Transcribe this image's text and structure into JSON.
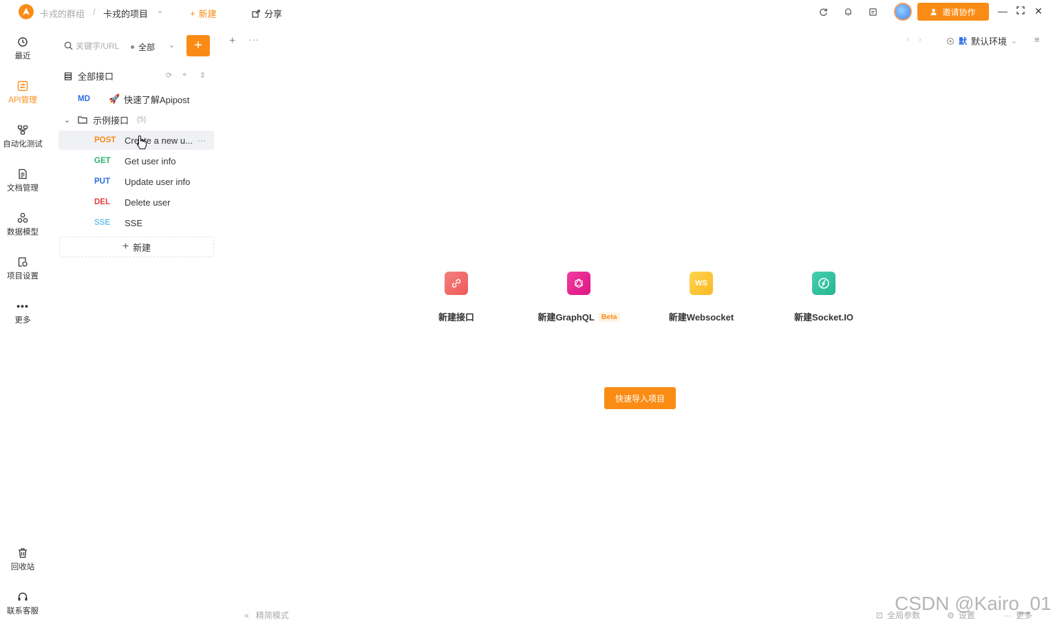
{
  "titlebar": {
    "team": "卡戎的群组",
    "separator": "/",
    "project": "卡戎的项目",
    "new_label": "新建",
    "share_label": "分享",
    "invite_label": "邀请协作"
  },
  "leftnav": {
    "items": [
      {
        "label": "最近",
        "icon": "history-icon"
      },
      {
        "label": "API管理",
        "icon": "api-icon"
      },
      {
        "label": "自动化测试",
        "icon": "automation-icon"
      },
      {
        "label": "文档管理",
        "icon": "document-icon"
      },
      {
        "label": "数据模型",
        "icon": "data-model-icon"
      },
      {
        "label": "项目设置",
        "icon": "project-settings-icon"
      },
      {
        "label": "更多",
        "icon": "more-icon"
      }
    ],
    "bottom": [
      {
        "label": "回收站",
        "icon": "trash-icon"
      },
      {
        "label": "联系客服",
        "icon": "headset-icon"
      }
    ]
  },
  "sidebar": {
    "search_placeholder": "关键字/URL",
    "filter_value": "全部",
    "root_label": "全部接口",
    "md_item": {
      "method": "MD",
      "label": "快速了解Apipost"
    },
    "folder": {
      "label": "示例接口",
      "count": "(5)"
    },
    "apis": [
      {
        "method": "POST",
        "label": "Create a new u..."
      },
      {
        "method": "GET",
        "label": "Get user info"
      },
      {
        "method": "PUT",
        "label": "Update user info"
      },
      {
        "method": "DEL",
        "label": "Delete user"
      },
      {
        "method": "SSE",
        "label": "SSE"
      }
    ],
    "new_label": "新建"
  },
  "main": {
    "env_tag": "默",
    "env_label": "默认环境",
    "quick_actions": [
      {
        "label": "新建接口",
        "color": "#f06a6a"
      },
      {
        "label": "新建GraphQL",
        "badge": "Beta",
        "color": "#e91e8c"
      },
      {
        "label": "新建Websocket",
        "icon_text": "WS",
        "color": "#fcc43a"
      },
      {
        "label": "新建Socket.IO",
        "color": "#35c4a3"
      }
    ],
    "import_label": "快速导入项目"
  },
  "footer": {
    "simple_mode": "精简模式",
    "global_params": "全局参数",
    "settings": "设置",
    "more": "更多"
  },
  "watermark": "CSDN @Kairo_01",
  "colors": {
    "accent": "#fa8c16"
  }
}
